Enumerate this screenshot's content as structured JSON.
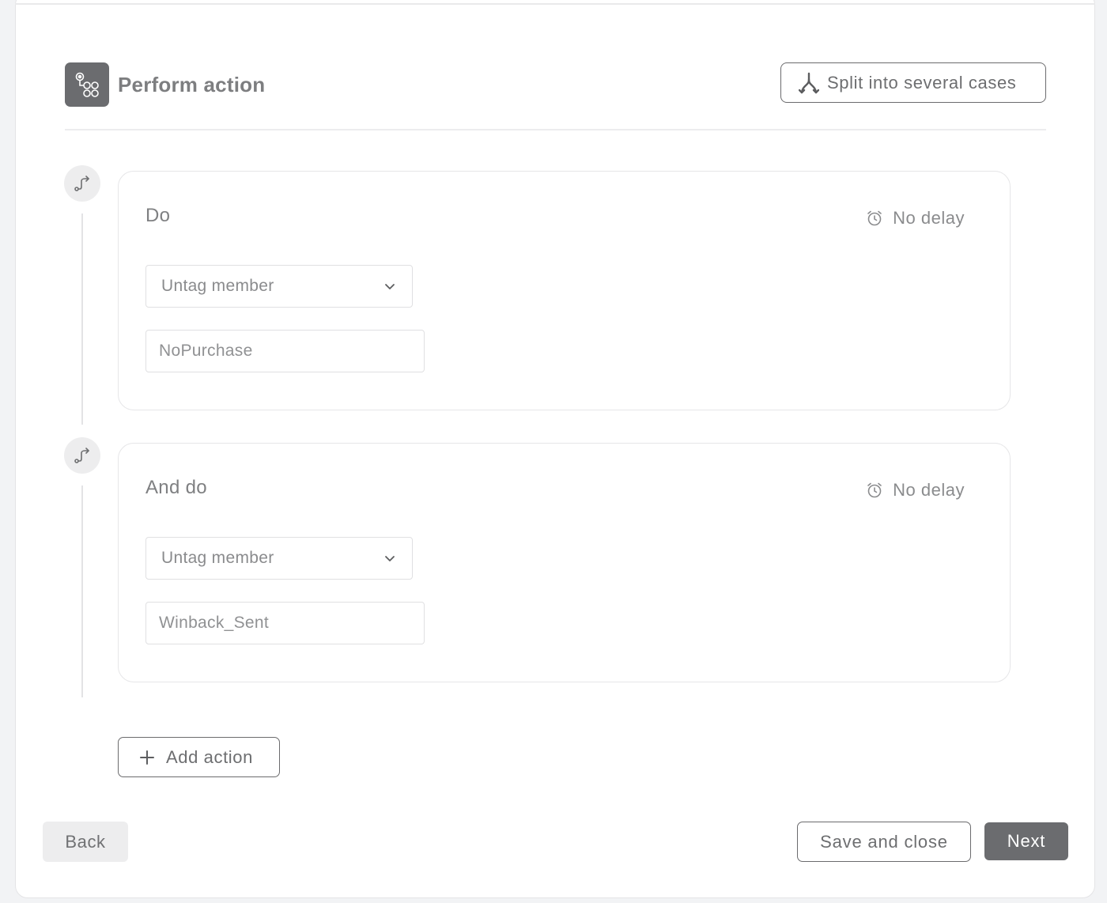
{
  "header": {
    "title": "Perform action",
    "icon": "workflow-icon",
    "split_button": {
      "label": "Split into several cases",
      "icon": "split-icon"
    }
  },
  "actions": [
    {
      "title": "Do",
      "delay": "No delay",
      "action_type": "Untag member",
      "tag_value": "NoPurchase"
    },
    {
      "title": "And do",
      "delay": "No delay",
      "action_type": "Untag member",
      "tag_value": "Winback_Sent"
    }
  ],
  "add_action": {
    "label": "Add action",
    "icon": "plus-icon"
  },
  "footer": {
    "back_label": "Back",
    "save_label": "Save and close",
    "next_label": "Next"
  },
  "colors": {
    "primary": "#6b6c6f",
    "border": "#e6e6e8",
    "background": "#f2f3f5"
  }
}
